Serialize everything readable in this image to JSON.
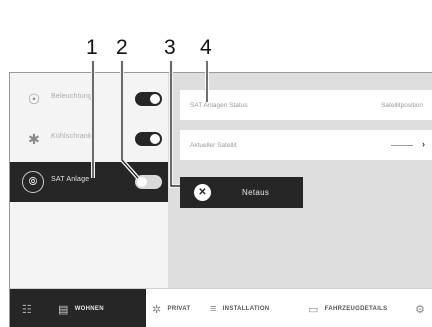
{
  "callouts": [
    "1",
    "2",
    "3",
    "4"
  ],
  "sidebar": {
    "items": [
      {
        "label": "Beleuchtung",
        "icon": "lightbulb-icon",
        "glyph": "☉",
        "toggle_on": true
      },
      {
        "label": "Kühlschrank",
        "icon": "snowflake-icon",
        "glyph": "✱",
        "toggle_on": true
      },
      {
        "label": "SAT Anlage",
        "icon": "satellite-icon",
        "glyph": "⦾",
        "toggle_on": false
      }
    ]
  },
  "content": {
    "status_row": {
      "label": "SAT Anlagen Status",
      "value": "Satellitposition"
    },
    "satellite_row": {
      "label": "Aktueller Satellit",
      "chevron": "›"
    },
    "netaus_button": {
      "label": "Netaus",
      "icon": "close-icon",
      "glyph": "✕"
    }
  },
  "bottom_nav": {
    "grid_icon": "☷",
    "tabs": [
      {
        "label": "WOHNEN",
        "icon": "home-icon",
        "glyph": "▤"
      },
      {
        "label": "PRIVAT",
        "icon": "shower-icon",
        "glyph": "✲"
      },
      {
        "label": "INSTALLATION",
        "icon": "installation-icon",
        "glyph": "≡"
      },
      {
        "label": "FAHRZEUGDETAILS",
        "icon": "vehicle-icon",
        "glyph": "▭"
      },
      {
        "label": "",
        "icon": "gear-icon",
        "glyph": "⚙"
      }
    ]
  },
  "colors": {
    "dark": "#262626",
    "panel": "#dedede",
    "sidebar": "#f4f4f4"
  }
}
